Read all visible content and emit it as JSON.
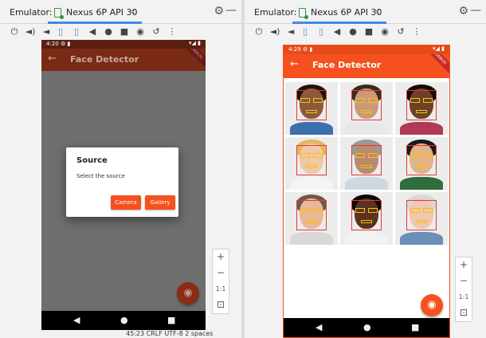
{
  "emulator_label": "Emulator:",
  "device_tab": "Nexus 6P API 30",
  "tab_close": "×",
  "gear_glyph": "⚙",
  "minimize_glyph": "—",
  "toolbar_icons": [
    "power",
    "volume-up",
    "volume-down",
    "rotate-left",
    "rotate-right",
    "back",
    "home",
    "overview",
    "screenshot",
    "snapshot",
    "more"
  ],
  "toolbar_glyphs": [
    "⏻",
    "◄)",
    "◄",
    "▯",
    "▯",
    "◀",
    "●",
    "■",
    "◉",
    "↺",
    "⋮"
  ],
  "nav_glyphs": [
    "◀",
    "●",
    "■"
  ],
  "zoom": {
    "plus": "+",
    "minus": "−",
    "one_to_one": "1:1",
    "fit": "⊡"
  },
  "left_phone": {
    "time": "4:20",
    "status_icons": "⚙ ▮",
    "signal": "▾◢ ▮",
    "back": "←",
    "app_title": "Face Detector",
    "debug_banner": "DEBUG",
    "dialog": {
      "title": "Source",
      "message": "Select the source",
      "camera_button": "Camera",
      "gallery_button": "Gallery"
    },
    "fab_glyph": "◉"
  },
  "right_phone": {
    "time": "4:29",
    "status_icons": "⚙ ▮",
    "signal": "▾◢ ▮",
    "back": "←",
    "app_title": "Face Detector",
    "debug_banner": "DEBUG",
    "fab_glyph": "◉"
  },
  "faces": [
    {
      "skin": "#8a5a3c",
      "hair": "#1e140e",
      "shirt": "#3a6fb0"
    },
    {
      "skin": "#c99a7a",
      "hair": "#3a2a1c",
      "shirt": "#e8e8e8"
    },
    {
      "skin": "#6b4128",
      "hair": "#120b08",
      "shirt": "#b03a55"
    },
    {
      "skin": "#f0c8a8",
      "hair": "#e0b860",
      "shirt": "#f4f4f4"
    },
    {
      "skin": "#b98a70",
      "hair": "#9a9a9a",
      "shirt": "#cfd8e0"
    },
    {
      "skin": "#e2b18e",
      "hair": "#1a1a1a",
      "shirt": "#2f6e3c"
    },
    {
      "skin": "#e8b898",
      "hair": "#6b5a4a",
      "shirt": "#d8d8d8"
    },
    {
      "skin": "#5a3322",
      "hair": "#0d0806",
      "shirt": "#f2f2f2"
    },
    {
      "skin": "#f0c8b0",
      "hair": "#d8d8d8",
      "shirt": "#6a8fb8"
    }
  ],
  "statusbar": "45:23    CRLF    UTF-8    2 spaces",
  "colors": {
    "orange": "#f4511e",
    "dimmed_appbar": "#7a2a14",
    "scrim": "#6e6e6e",
    "box_red": "#e53935",
    "landmark_yellow": "#f9c00a"
  }
}
